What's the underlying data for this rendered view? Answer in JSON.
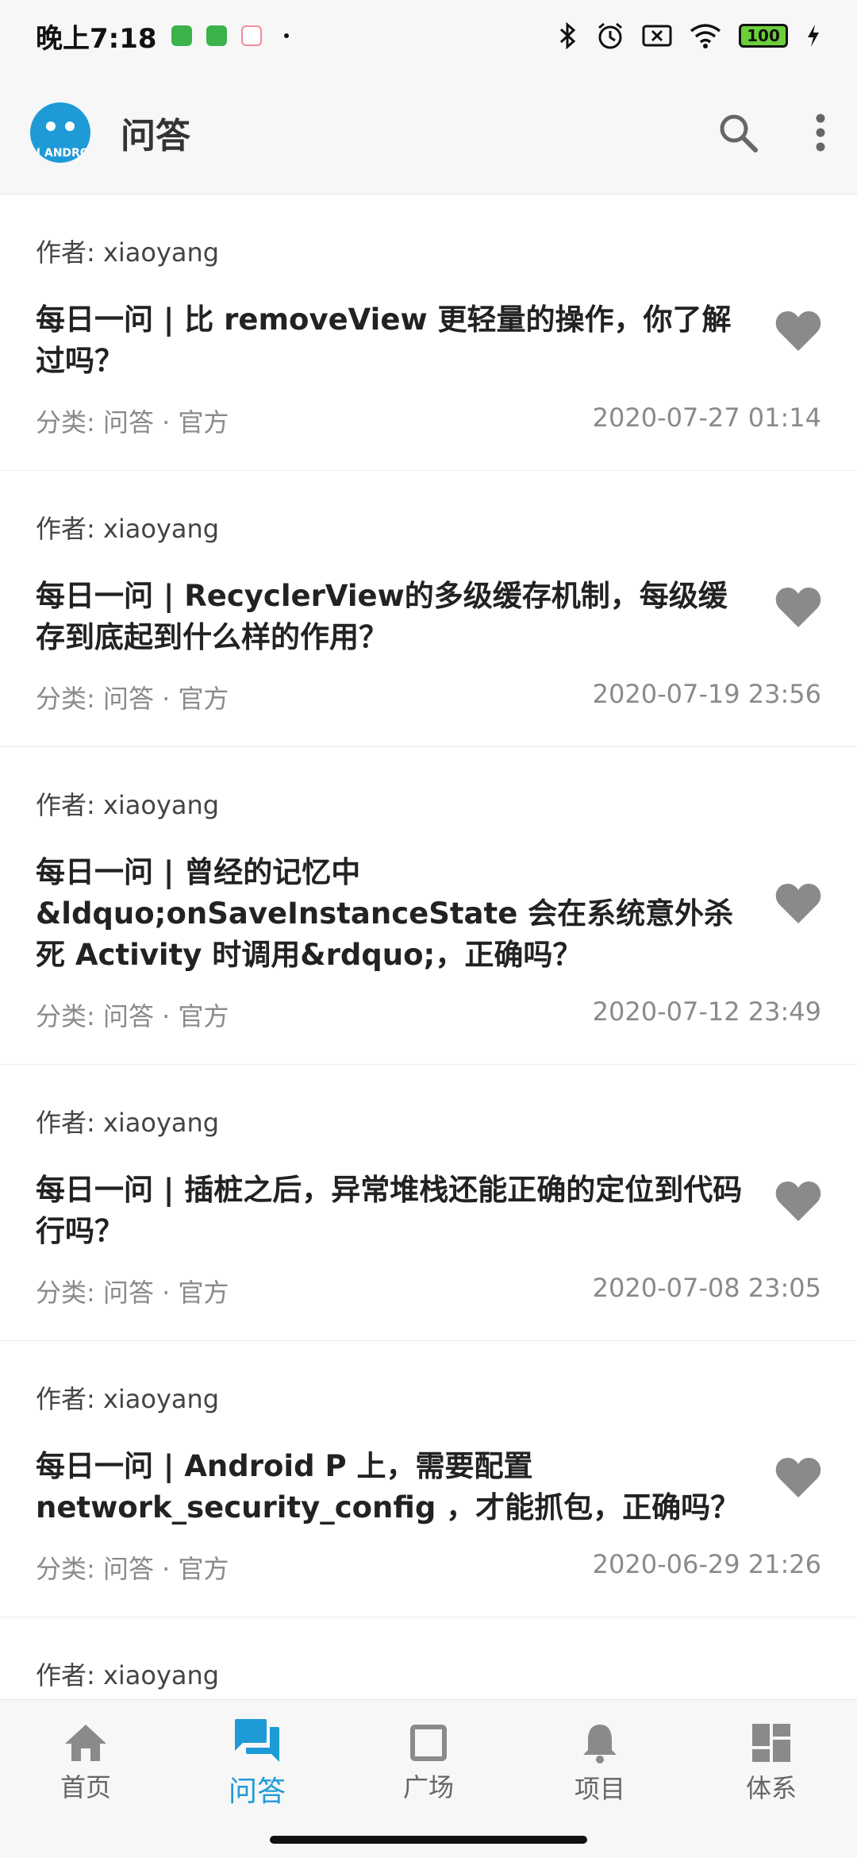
{
  "status_bar": {
    "time": "晚上7:18",
    "battery": "100"
  },
  "app_bar": {
    "logo_text": "N ANDRO",
    "title": "问答",
    "icons": [
      "search-icon",
      "more-vert-icon"
    ]
  },
  "articles": [
    {
      "author": "作者: xiaoyang",
      "title": "每日一问 | 比 removeView 更轻量的操作，你了解过吗？",
      "category": "分类: 问答 · 官方",
      "date": "2020-07-27 01:14"
    },
    {
      "author": "作者: xiaoyang",
      "title": "每日一问 | RecyclerView的多级缓存机制，每级缓存到底起到什么样的作用？",
      "category": "分类: 问答 · 官方",
      "date": "2020-07-19 23:56"
    },
    {
      "author": "作者: xiaoyang",
      "title": "每日一问 | 曾经的记忆中 &ldquo;onSaveInstanceState 会在系统意外杀死 Activity 时调用&rdquo;，正确吗？",
      "category": "分类: 问答 · 官方",
      "date": "2020-07-12 23:49"
    },
    {
      "author": "作者: xiaoyang",
      "title": "每日一问 | 插桩之后，异常堆栈还能正确的定位到代码行吗？",
      "category": "分类: 问答 · 官方",
      "date": "2020-07-08 23:05"
    },
    {
      "author": "作者: xiaoyang",
      "title": "每日一问 | Android P 上，需要配置 network_security_config ，才能抓包，正确吗？",
      "category": "分类: 问答 · 官方",
      "date": "2020-06-29 21:26"
    },
    {
      "author": "作者: xiaoyang"
    }
  ],
  "bottom_nav": [
    {
      "label": "首页",
      "icon": "home-icon",
      "active": false
    },
    {
      "label": "问答",
      "icon": "forum-icon",
      "active": true
    },
    {
      "label": "广场",
      "icon": "square-icon",
      "active": false
    },
    {
      "label": "项目",
      "icon": "bell-icon",
      "active": false
    },
    {
      "label": "体系",
      "icon": "dashboard-icon",
      "active": false
    }
  ],
  "colors": {
    "accent": "#1e9bd7",
    "heart": "#8a8a8a",
    "nav_inactive": "#666666"
  }
}
